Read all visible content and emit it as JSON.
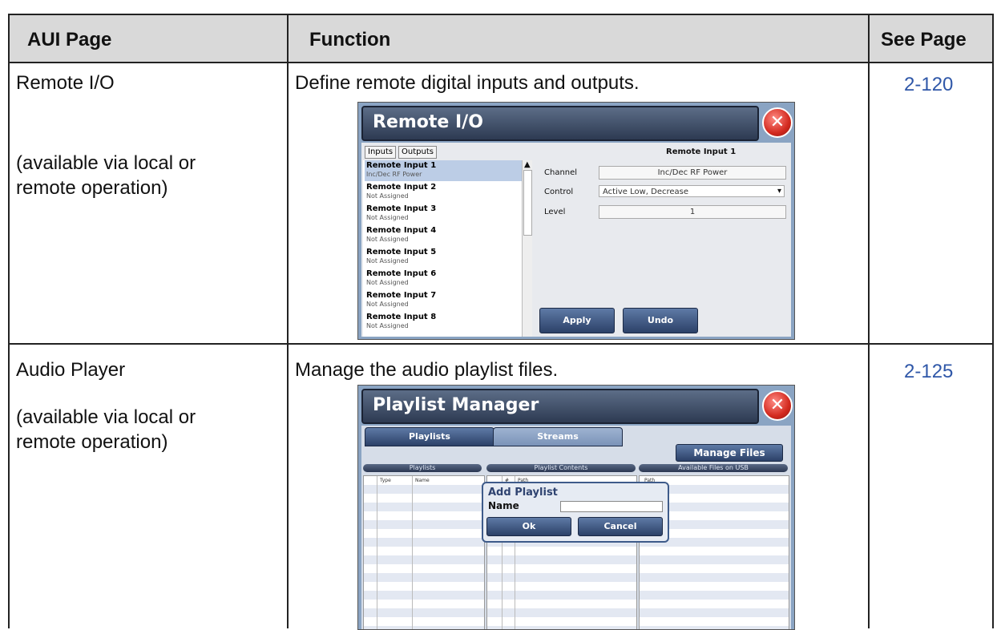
{
  "table": {
    "headers": {
      "page": "AUI Page",
      "function": "Function",
      "see": "See Page"
    },
    "rows": [
      {
        "page": "Remote I/O",
        "availability": "(available via local or remote operation)",
        "function": "Define remote digital inputs and outputs.",
        "see": "2-120"
      },
      {
        "page": "Audio Player",
        "availability": "(available via local or remote operation)",
        "function": "Manage the audio playlist files.",
        "see": "2-125"
      }
    ]
  },
  "remote_io": {
    "title": "Remote I/O",
    "close_icon": "close-icon",
    "tabs": [
      "Inputs",
      "Outputs"
    ],
    "items": [
      {
        "name": "Remote Input 1",
        "status": "Inc/Dec RF Power"
      },
      {
        "name": "Remote Input 2",
        "status": "Not Assigned"
      },
      {
        "name": "Remote Input 3",
        "status": "Not Assigned"
      },
      {
        "name": "Remote Input 4",
        "status": "Not Assigned"
      },
      {
        "name": "Remote Input 5",
        "status": "Not Assigned"
      },
      {
        "name": "Remote Input 6",
        "status": "Not Assigned"
      },
      {
        "name": "Remote Input 7",
        "status": "Not Assigned"
      },
      {
        "name": "Remote Input 8",
        "status": "Not Assigned"
      }
    ],
    "detail_title": "Remote Input 1",
    "channel_label": "Channel",
    "channel_value": "Inc/Dec RF Power",
    "control_label": "Control",
    "control_value": "Active Low, Decrease",
    "level_label": "Level",
    "level_value": "1",
    "apply": "Apply",
    "undo": "Undo"
  },
  "playlist": {
    "title": "Playlist Manager",
    "tabs": [
      "Playlists",
      "Streams"
    ],
    "manage_files": "Manage Files",
    "sections": [
      "Playlists",
      "Playlist Contents",
      "Available Files on USB"
    ],
    "cols_playlists": [
      "Type",
      "Name"
    ],
    "cols_contents": [
      "#",
      "Path"
    ],
    "cols_files": [
      "Path"
    ],
    "dialog": {
      "title": "Add Playlist",
      "name_label": "Name",
      "name_value": "",
      "ok": "Ok",
      "cancel": "Cancel"
    }
  },
  "colors": {
    "header_bg": "#d9d9d9",
    "link": "#2f57a8",
    "aui_frame": "#8aa4c3"
  }
}
